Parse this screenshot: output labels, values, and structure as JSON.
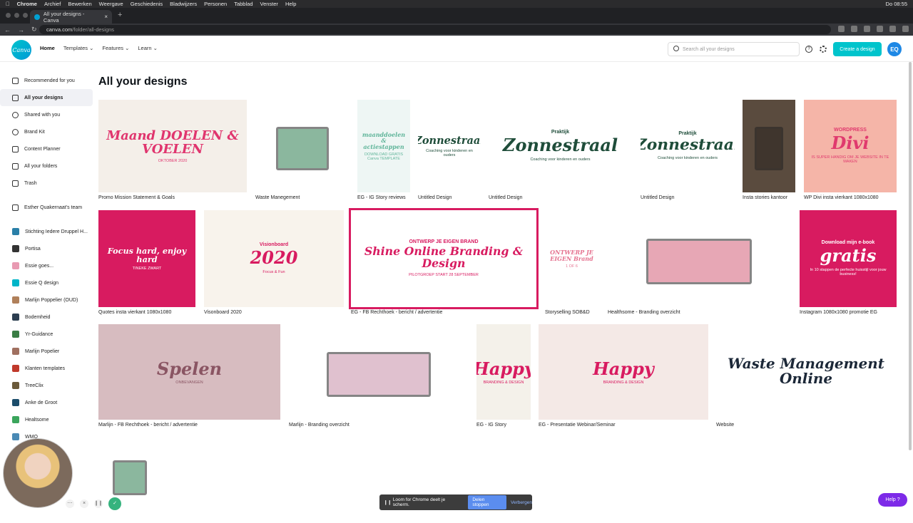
{
  "mac_menu": {
    "apple": "",
    "items": [
      "Chrome",
      "Archief",
      "Bewerken",
      "Weergave",
      "Geschiedenis",
      "Bladwijzers",
      "Personen",
      "Tabblad",
      "Venster",
      "Help"
    ],
    "clock": "Do 08:55"
  },
  "browser": {
    "tab_title": "All your designs - Canva",
    "url_host": "canva.com",
    "url_path": "/folder/all-designs"
  },
  "header": {
    "logo_text": "Canva",
    "nav": [
      "Home",
      "Templates",
      "Features",
      "Learn"
    ],
    "search_placeholder": "Search all your designs",
    "create_label": "Create a design",
    "avatar_initials": "EQ"
  },
  "sidebar": {
    "main_items": [
      "Recommended for you",
      "All your designs",
      "Shared with you",
      "Brand Kit",
      "Content Planner",
      "All your folders",
      "Trash"
    ],
    "team": "Esther Quakernaat's team",
    "teams": [
      "Stichting Iedere Druppel H...",
      "Portisa",
      "Essie goes...",
      "Essie Q design",
      "Marlijn Poppelier (OUD)",
      "Bodemheid",
      "Yr-Guidance",
      "Marlijn Popelier",
      "Klanten templates",
      "TreeClix",
      "Anke de Groot",
      "Healtsome",
      "WMO"
    ],
    "team_colors": [
      "#2a7fa8",
      "#333333",
      "#e89ab2",
      "#00b5c8",
      "#b0805a",
      "#2c3e50",
      "#3a7d44",
      "#a07060",
      "#c0392b",
      "#6b5a3a",
      "#1b4d6b",
      "#3ba55c",
      "#4a8ab5"
    ]
  },
  "main": {
    "title": "All your designs",
    "designs": [
      {
        "caption": "Promo Mission Statement & Goals",
        "text": "Maand DOELEN & VOELEN",
        "sub": "OKTOBER 2020",
        "bg": "#f4efe9",
        "accent": "#e0356e"
      },
      {
        "caption": "Waste Manegement",
        "text": "",
        "sub": "",
        "bg": "#ffffff",
        "accent": "#2e7d4f"
      },
      {
        "caption": "EG - IG Story reviews",
        "text": "maanddoelen & actiestappen",
        "sub": "DOWNLOAD GRATIS Canva TEMPLATE",
        "bg": "#eef6f4",
        "accent": "#60b59a"
      },
      {
        "caption": "Untitled Design",
        "text": "Zonnestraal",
        "sub": "Coaching voor kinderen en ouders",
        "bg": "#ffffff",
        "accent": "#1f4d3a"
      },
      {
        "caption": "Untitled Design",
        "text": "Zonnestraal",
        "sub": "Coaching voor kinderen en ouders",
        "bg": "#ffffff",
        "accent": "#1f4d3a",
        "pre": "Praktijk"
      },
      {
        "caption": "Untitled Design",
        "text": "Zonnestraal",
        "sub": "Coaching voor kinderen en ouders",
        "bg": "#ffffff",
        "accent": "#1f4d3a",
        "pre": "Praktijk"
      },
      {
        "caption": "Insta stories kantoor",
        "text": "",
        "sub": "",
        "bg": "#5a4b3e",
        "accent": "#2a2420"
      },
      {
        "caption": "WP Divi insta vierkant 1080x1080",
        "text": "Divi",
        "sub": "IS SUPER HANDIG OM JE WEBSITE IN TE MAKEN",
        "bg": "#f5b5a8",
        "accent": "#e03a6e",
        "pre": "WORDPRESS"
      },
      {
        "caption": "Quotes insta vierkant 1080x1080",
        "text": "Focus hard, enjoy hard",
        "sub": "TINEKE ZWART",
        "bg": "#d81b60",
        "accent": "#ffffff"
      },
      {
        "caption": "Visonboard 2020",
        "text": "2020",
        "sub": "Focus & Fun",
        "bg": "#f8f3ec",
        "accent": "#d81b60",
        "pre": "Visionboard"
      },
      {
        "caption": "EG - FB Rechthoek - bericht / advertentie",
        "text": "Shine Online Branding & Design",
        "sub": "PILOTGROEP START 28 SEPTEMBER",
        "bg": "#ffffff",
        "accent": "#d81b60",
        "pre": "ONTWERP JE EIGEN BRAND"
      },
      {
        "caption": "Storyselling SOB&D",
        "text": "ONTWERP JE EIGEN Brand",
        "sub": "1 OF 6",
        "bg": "#ffffff",
        "accent": "#e57390"
      },
      {
        "caption": "Healthsome - Branding overzicht",
        "text": "",
        "sub": "",
        "bg": "#ffffff",
        "accent": "#d4607a"
      },
      {
        "caption": "Instagram 1080x1080 promotie EG",
        "text": "gratis",
        "sub": "In 10 stappen de perfecte huisstijl voor jouw business!",
        "bg": "#d81b60",
        "accent": "#ffffff",
        "pre": "Download mijn e-book"
      },
      {
        "caption": "Marlijn - FB Rechthoek - bericht / advertentie",
        "text": "Spelen",
        "sub": "ONBEVANGEN",
        "bg": "#d7bcc0",
        "accent": "#8a5563"
      },
      {
        "caption": "Marlijn - Branding overzicht",
        "text": "",
        "sub": "",
        "bg": "#ffffff",
        "accent": "#c890a8"
      },
      {
        "caption": "EG - IG Story",
        "text": "Happy",
        "sub": "BRANDING & DESIGN",
        "bg": "#f4f1ea",
        "accent": "#d81b60"
      },
      {
        "caption": "EG - Presentatie Webinar/Seminar",
        "text": "Happy",
        "sub": "BRANDING & DESIGN",
        "bg": "#f4e9e6",
        "accent": "#d81b60"
      },
      {
        "caption": "Website",
        "text": "Waste Management Online",
        "sub": "",
        "bg": "#ffffff",
        "accent": "#1c2838"
      },
      {
        "caption": "",
        "text": "",
        "sub": "",
        "bg": "#ffffff",
        "accent": "#2e7d4f"
      }
    ]
  },
  "loom": {
    "message": "Loom for Chrome deelt je scherm.",
    "stop": "Delen stoppen",
    "hide": "Verbergen"
  },
  "help_button": "Help ?"
}
